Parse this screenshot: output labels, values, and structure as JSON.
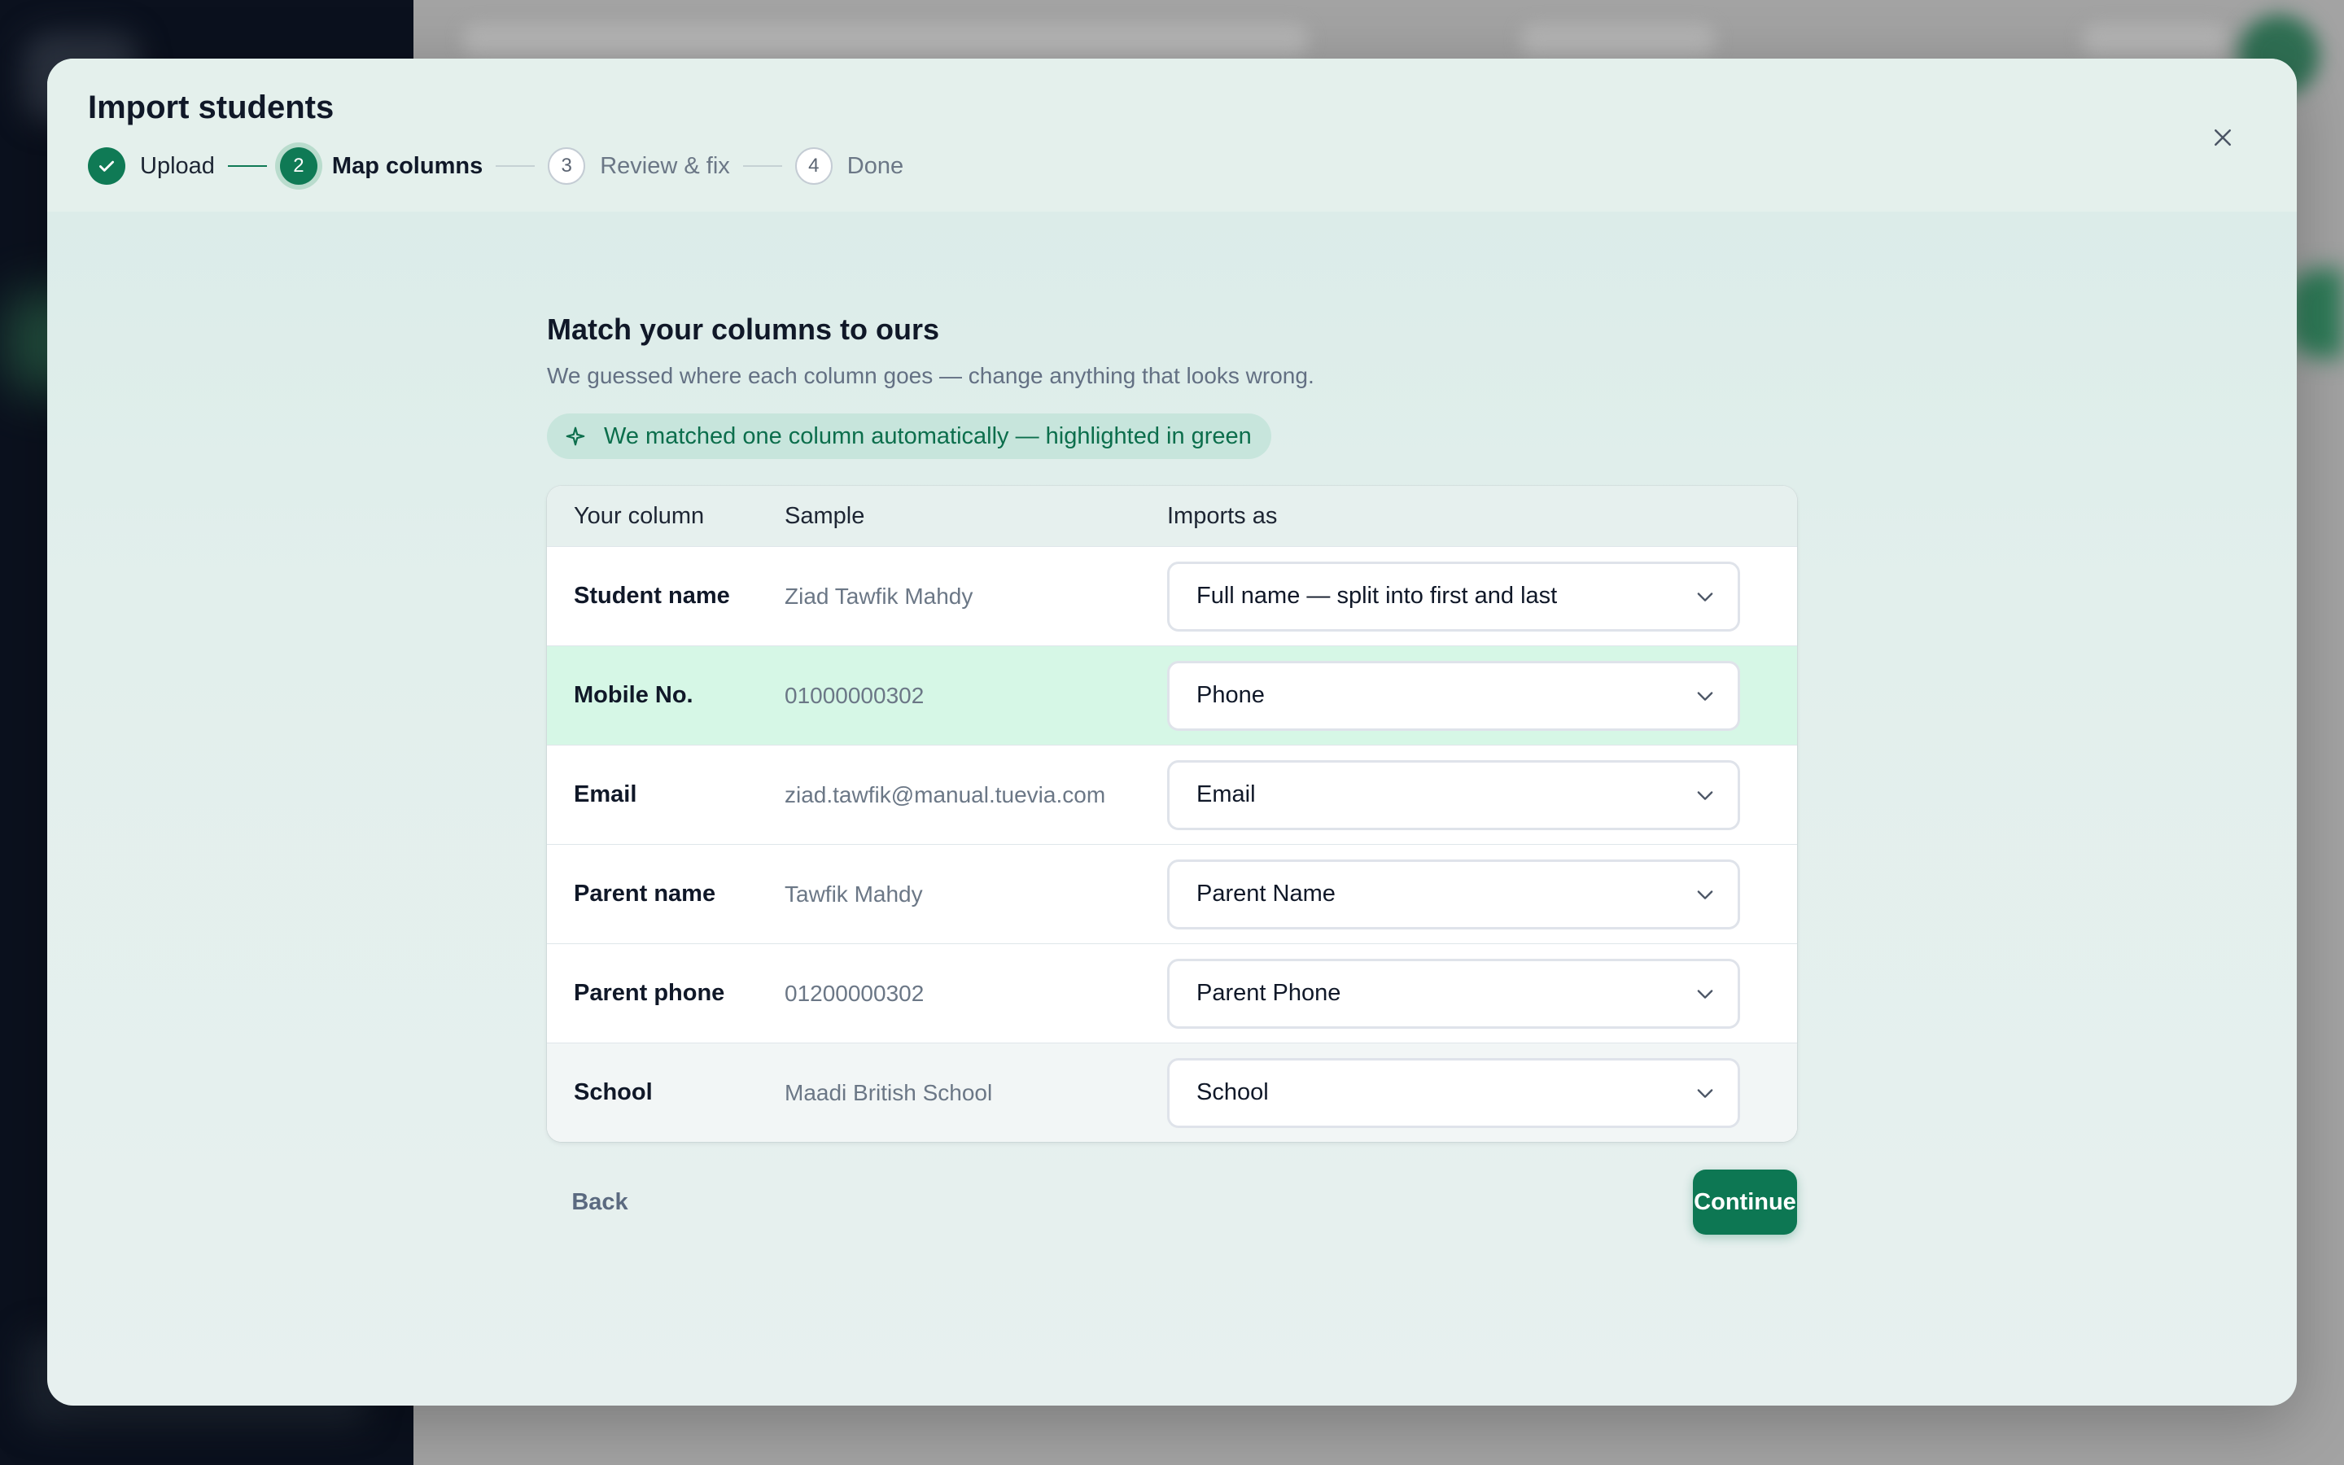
{
  "modal": {
    "title": "Import students"
  },
  "stepper": {
    "steps": [
      {
        "label": "Upload",
        "number": "1",
        "state": "done"
      },
      {
        "label": "Map columns",
        "number": "2",
        "state": "active"
      },
      {
        "label": "Review & fix",
        "number": "3",
        "state": "todo"
      },
      {
        "label": "Done",
        "number": "4",
        "state": "todo"
      }
    ]
  },
  "mapping": {
    "title": "Match your columns to ours",
    "subtitle": "We guessed where each column goes — change anything that looks wrong.",
    "auto_badge": "We matched one column automatically — highlighted in green",
    "headers": {
      "your_column": "Your column",
      "sample": "Sample",
      "imports_as": "Imports as"
    },
    "rows": [
      {
        "column": "Student name",
        "sample": "Ziad Tawfik Mahdy",
        "imports_as": "Full name — split into first and last"
      },
      {
        "column": "Mobile No.",
        "sample": "01000000302",
        "imports_as": "Phone"
      },
      {
        "column": "Email",
        "sample": "ziad.tawfik@manual.tuevia.com",
        "imports_as": "Email"
      },
      {
        "column": "Parent name",
        "sample": "Tawfik Mahdy",
        "imports_as": "Parent Name"
      },
      {
        "column": "Parent phone",
        "sample": "01200000302",
        "imports_as": "Parent Phone"
      },
      {
        "column": "School",
        "sample": "Maadi British School",
        "imports_as": "School"
      }
    ]
  },
  "footer": {
    "back_label": "Back",
    "continue_label": "Continue"
  },
  "colors": {
    "brand_green": "#0f7a55",
    "matched_row": "#d6f7e6",
    "badge_bg": "#c7e5dc"
  },
  "icons": {
    "close": "close-icon",
    "step_done": "check-icon",
    "badge": "sparkle-icon",
    "select": "chevron-down-icon"
  }
}
